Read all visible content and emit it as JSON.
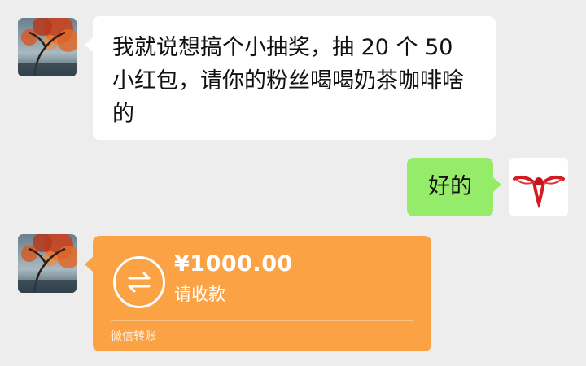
{
  "messages": [
    {
      "from": "other",
      "text": "我就说想搞个小抽奖，抽 20 个 50 小红包，请你的粉丝喝喝奶茶咖啡啥的"
    },
    {
      "from": "me",
      "text": "好的"
    }
  ],
  "transfer": {
    "amount": "¥1000.00",
    "status": "请收款",
    "footer": "微信转账"
  },
  "colors": {
    "background": "#ededed",
    "incoming_bubble": "#ffffff",
    "outgoing_bubble": "#95ec69",
    "transfer_card": "#fba244"
  },
  "icons": [
    "avatar-autumn-tree",
    "transfer-arrows-icon",
    "red-knot-avatar"
  ]
}
